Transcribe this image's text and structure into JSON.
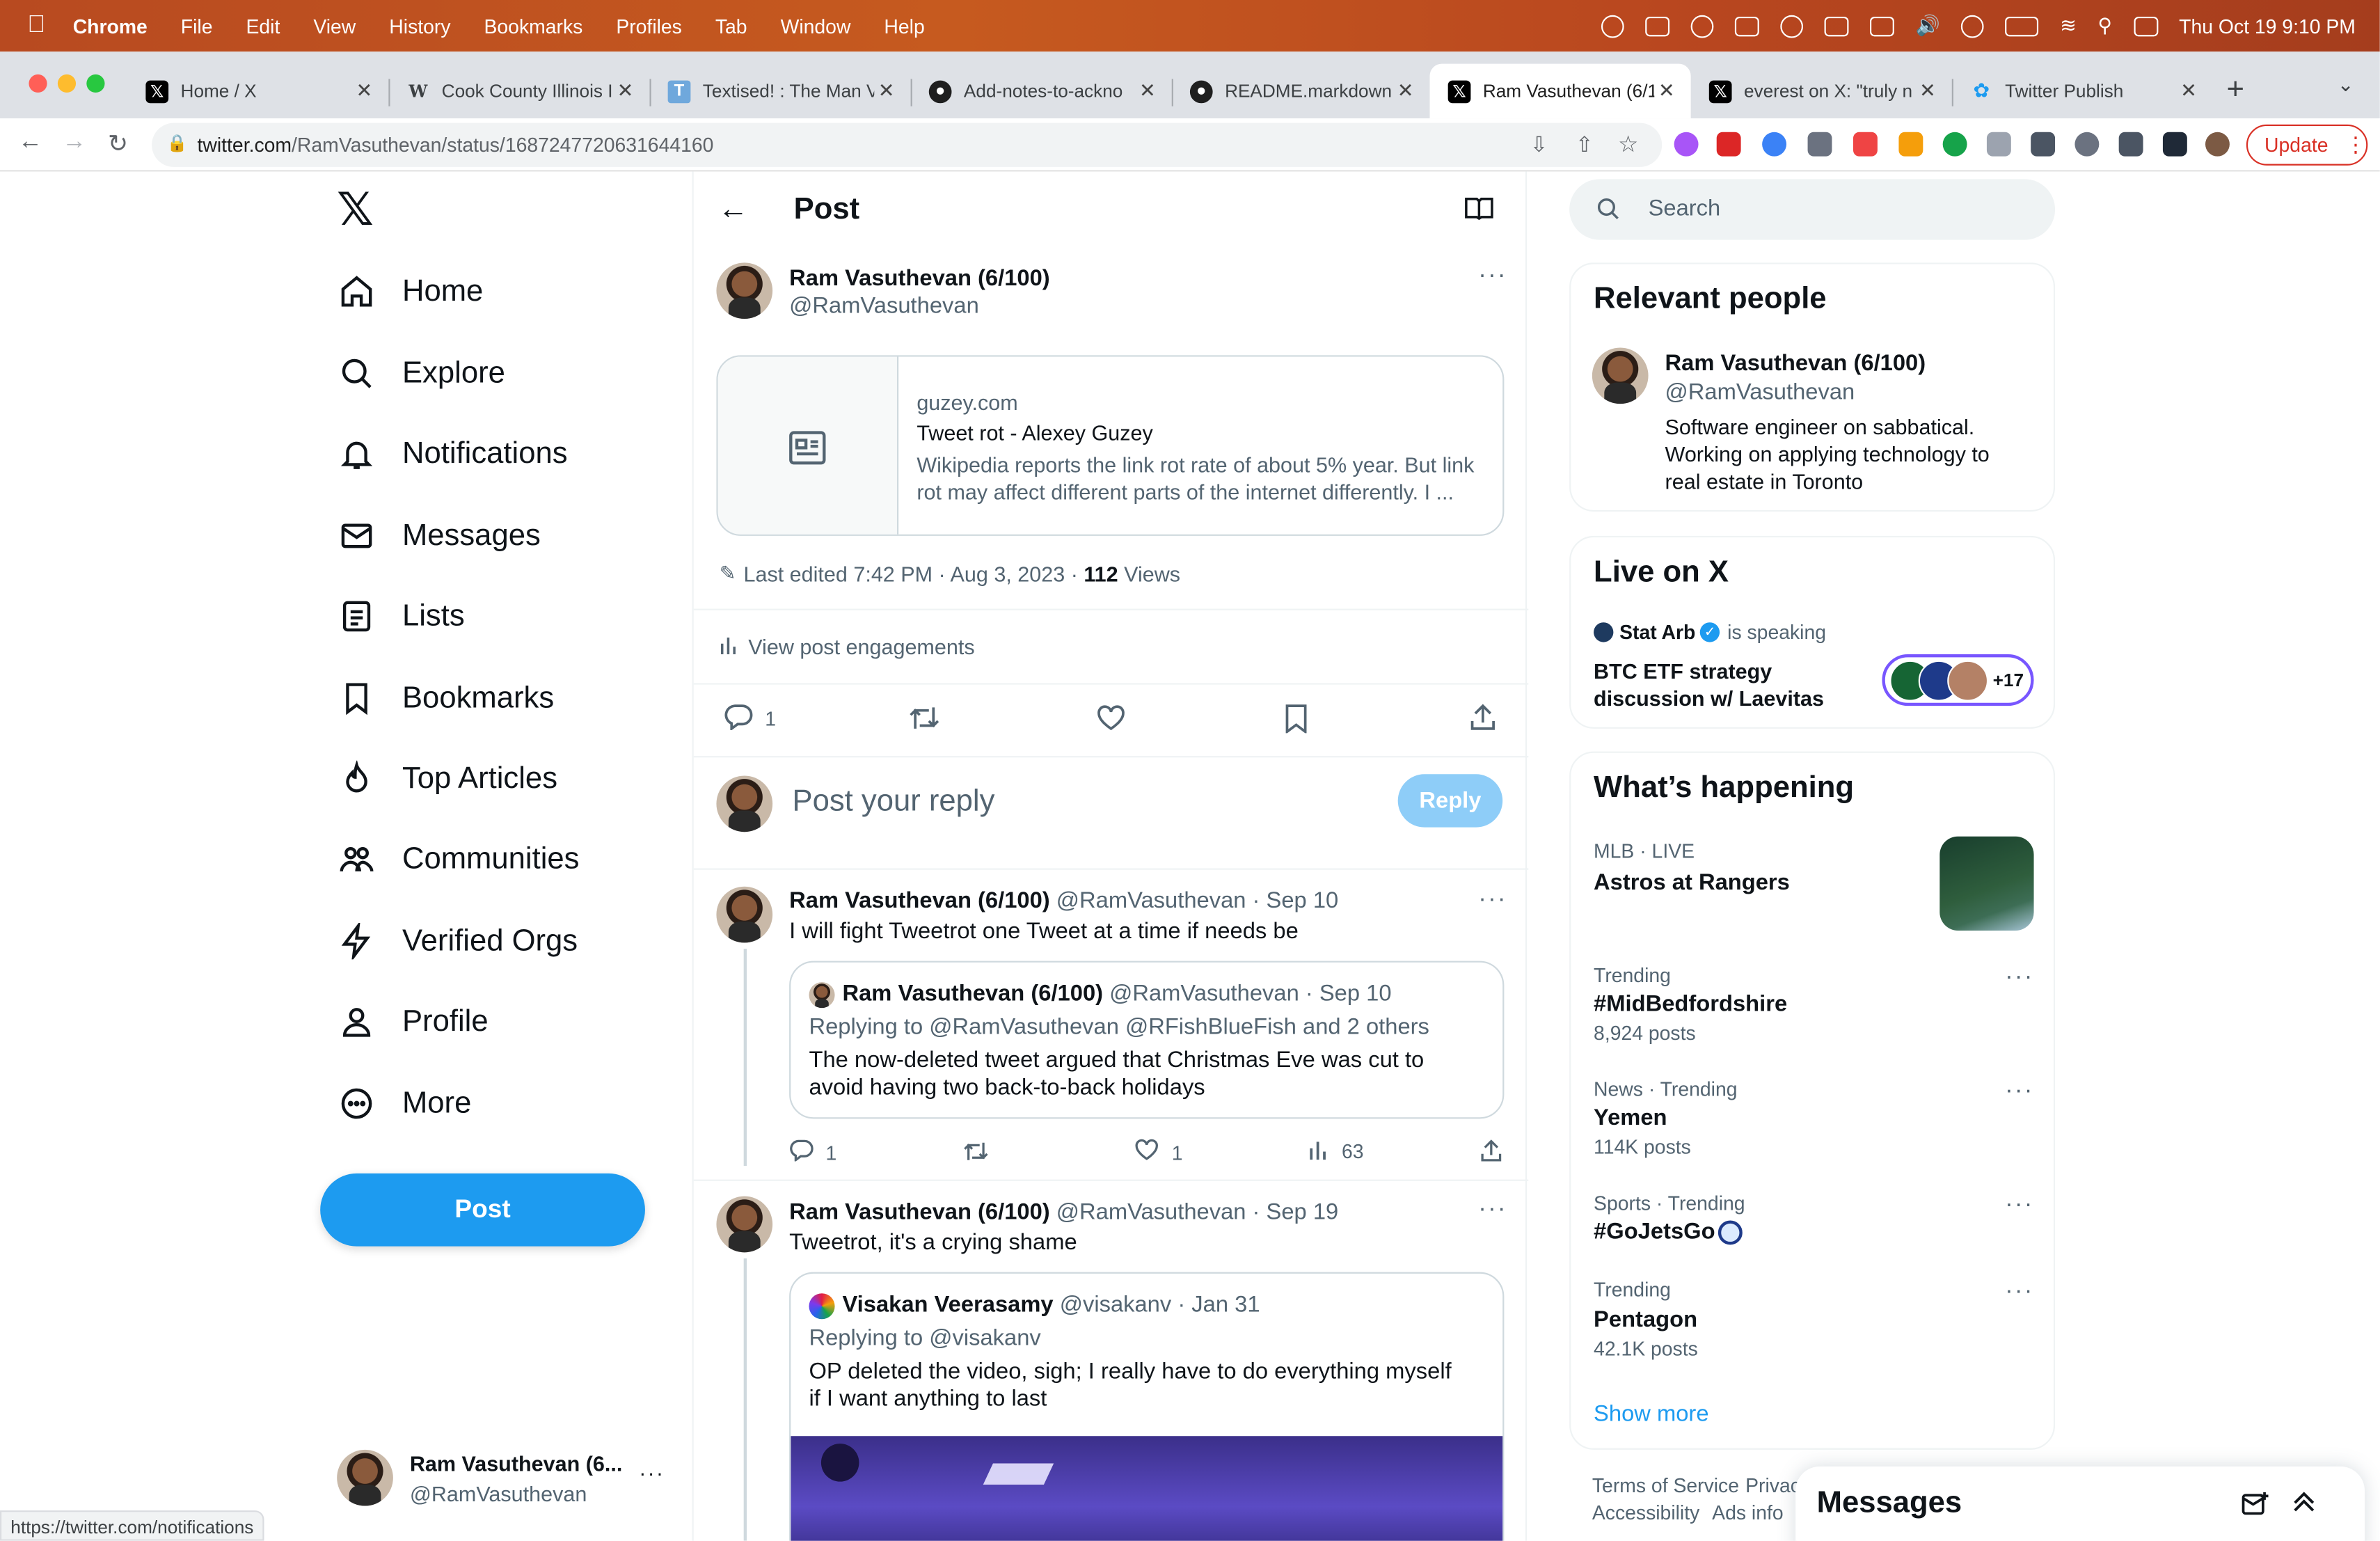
{
  "menubar": {
    "app": "Chrome",
    "menus": [
      "File",
      "Edit",
      "View",
      "History",
      "Bookmarks",
      "Profiles",
      "Tab",
      "Window",
      "Help"
    ],
    "clock": "Thu Oct 19  9:10 PM"
  },
  "tabs": [
    {
      "title": "Home / X",
      "icon": "x-logo-icon"
    },
    {
      "title": "Cook County Illinois I",
      "icon": "wikipedia-icon"
    },
    {
      "title": "Textised! : The Man V",
      "icon": "textise-icon"
    },
    {
      "title": "Add-notes-to-ackno",
      "icon": "github-icon"
    },
    {
      "title": "README.markdown",
      "icon": "github-icon"
    },
    {
      "title": "Ram Vasuthevan (6/1",
      "icon": "x-logo-icon"
    },
    {
      "title": "everest on X: \"truly n",
      "icon": "x-logo-icon"
    },
    {
      "title": "Twitter Publish",
      "icon": "twitter-bird-icon"
    }
  ],
  "address": {
    "host": "twitter.com",
    "path": "/RamVasuthevan/status/1687247720631644160",
    "update_label": "Update"
  },
  "nav": {
    "items": [
      "Home",
      "Explore",
      "Notifications",
      "Messages",
      "Lists",
      "Bookmarks",
      "Top Articles",
      "Communities",
      "Verified Orgs",
      "Profile",
      "More"
    ],
    "post_label": "Post",
    "account_name": "Ram Vasuthevan (6...",
    "account_handle": "@RamVasuthevan"
  },
  "post": {
    "header": "Post",
    "author_name": "Ram Vasuthevan (6/100)",
    "author_handle": "@RamVasuthevan",
    "link_card": {
      "domain": "guzey.com",
      "title": "Tweet rot - Alexey Guzey",
      "description": "Wikipedia reports the link rot rate of about 5% year. But link rot may affect different parts of the internet differently. I ..."
    },
    "edited": "Last edited 7:42 PM · Aug 3, 2023 · ",
    "views_count": "112",
    "views_label": " Views",
    "engagements": "View post engagements",
    "reply_count": "1",
    "reply_placeholder": "Post your reply",
    "reply_button": "Reply"
  },
  "replies": [
    {
      "name": "Ram Vasuthevan (6/100)",
      "meta": "@RamVasuthevan · Sep 10",
      "text": "I will fight Tweetrot one Tweet at a time if needs be",
      "quote": {
        "name": "Ram Vasuthevan (6/100)",
        "meta": "@RamVasuthevan · Sep 10",
        "replying_prefix": "Replying to ",
        "replying_to": "@RamVasuthevan @RFishBlueFish",
        "replying_suffix": " and 2 others",
        "text": "The now-deleted tweet argued that Christmas Eve was cut to avoid having two back-to-back holidays"
      },
      "stats": {
        "replies": "1",
        "likes": "1",
        "views": "63"
      }
    },
    {
      "name": "Ram Vasuthevan (6/100)",
      "meta": "@RamVasuthevan · Sep 19",
      "text": "Tweetrot, it's a crying shame",
      "quote": {
        "name": "Visakan Veerasamy",
        "meta": "@visakanv · Jan 31",
        "replying_prefix": "Replying to ",
        "replying_to": "@visakanv",
        "text": "OP deleted the video, sigh; I really have to do everything myself if I want anything to last"
      }
    }
  ],
  "right": {
    "search_placeholder": "Search",
    "relevant": {
      "title": "Relevant people",
      "name": "Ram Vasuthevan (6/100)",
      "handle": "@RamVasuthevan",
      "bio": "Software engineer on sabbatical. Working on applying technology to real estate in Toronto"
    },
    "live": {
      "title": "Live on X",
      "host": "Stat Arb",
      "status": "is speaking",
      "topic": "BTC ETF strategy discussion w/ Laevitas",
      "listeners": "+17"
    },
    "happening": {
      "title": "What’s happening",
      "featured_context": "MLB · LIVE",
      "featured_title": "Astros at Rangers",
      "trends": [
        {
          "context": "Trending",
          "name": "#MidBedfordshire",
          "count": "8,924 posts"
        },
        {
          "context": "News · Trending",
          "name": "Yemen",
          "count": "114K posts"
        },
        {
          "context": "Sports · Trending",
          "name": "#GoJetsGo",
          "count": ""
        },
        {
          "context": "Trending",
          "name": "Pentagon",
          "count": "42.1K posts"
        }
      ],
      "show_more": "Show more"
    },
    "footer": [
      "Terms of Service",
      "Privac",
      "Accessibility",
      "Ads info"
    ],
    "messages_title": "Messages"
  },
  "status_url": "https://twitter.com/notifications",
  "colors": {
    "accent": "#1d9bf0",
    "text": "#0f1419",
    "muted": "#536471",
    "update": "#d93025"
  }
}
